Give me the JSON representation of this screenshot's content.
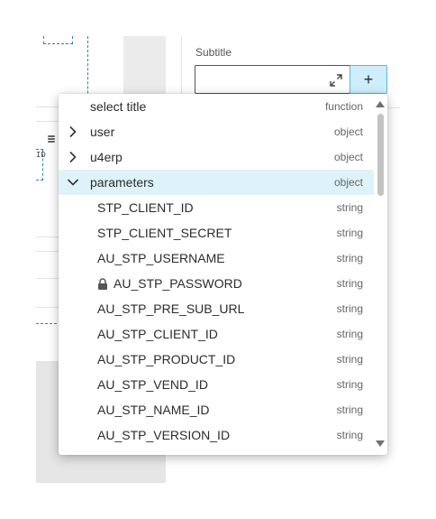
{
  "form": {
    "subtitle_label": "Subtitle",
    "subtitle_value": "",
    "add_label": "+"
  },
  "canvas": {
    "mini_label": "ID"
  },
  "dropdown": {
    "items": [
      {
        "label": "select title",
        "type": "function",
        "kind": "header"
      },
      {
        "label": "user",
        "type": "object",
        "kind": "collapsed"
      },
      {
        "label": "u4erp",
        "type": "object",
        "kind": "collapsed"
      },
      {
        "label": "parameters",
        "type": "object",
        "kind": "expanded",
        "selected": true
      },
      {
        "label": "STP_CLIENT_ID",
        "type": "string",
        "kind": "child"
      },
      {
        "label": "STP_CLIENT_SECRET",
        "type": "string",
        "kind": "child"
      },
      {
        "label": "AU_STP_USERNAME",
        "type": "string",
        "kind": "child"
      },
      {
        "label": "AU_STP_PASSWORD",
        "type": "string",
        "kind": "child",
        "icon": "lock-icon"
      },
      {
        "label": "AU_STP_PRE_SUB_URL",
        "type": "string",
        "kind": "child"
      },
      {
        "label": "AU_STP_CLIENT_ID",
        "type": "string",
        "kind": "child"
      },
      {
        "label": "AU_STP_PRODUCT_ID",
        "type": "string",
        "kind": "child"
      },
      {
        "label": "AU_STP_VEND_ID",
        "type": "string",
        "kind": "child"
      },
      {
        "label": "AU_STP_NAME_ID",
        "type": "string",
        "kind": "child"
      },
      {
        "label": "AU_STP_VERSION_ID",
        "type": "string",
        "kind": "child"
      }
    ]
  },
  "colors": {
    "accent": "#5bb7dd",
    "selected_row": "#def3f9",
    "add_button_bg": "#cdeefa"
  }
}
